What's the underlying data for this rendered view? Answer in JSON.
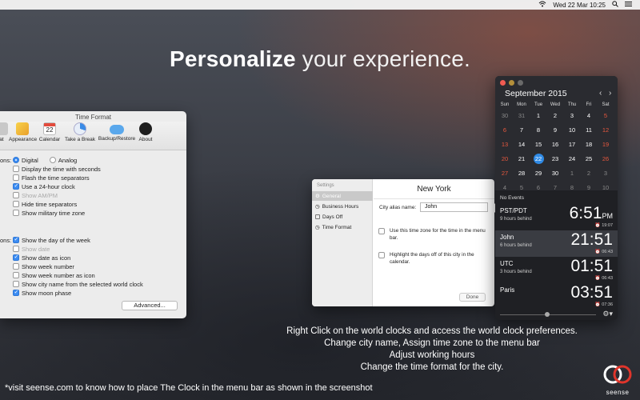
{
  "menubar": {
    "datetime": "Wed 22 Mar 10:25"
  },
  "headline": {
    "bold": "Personalize",
    "rest": " your experience."
  },
  "time_format_window": {
    "title": "Time Format",
    "toolbar": [
      {
        "label": "at",
        "icon": "time-format-icon"
      },
      {
        "label": "Appearance",
        "icon": "appearance-icon"
      },
      {
        "label": "Calendar",
        "icon": "calendar-icon",
        "day": "22"
      },
      {
        "label": "Take a Break",
        "icon": "break-pie-icon"
      },
      {
        "label": "Backup/Restore",
        "icon": "cloud-icon"
      },
      {
        "label": "About",
        "icon": "about-clock-icon"
      }
    ],
    "section1_label": "ons:",
    "format_digital": "Digital",
    "format_analog": "Analog",
    "options1": [
      {
        "label": "Display the time with seconds",
        "checked": false,
        "disabled": false
      },
      {
        "label": "Flash the time separators",
        "checked": false,
        "disabled": false
      },
      {
        "label": "Use a 24-hour clock",
        "checked": true,
        "disabled": false
      },
      {
        "label": "Show AM/PM",
        "checked": false,
        "disabled": true
      },
      {
        "label": "Hide time separators",
        "checked": false,
        "disabled": false
      },
      {
        "label": "Show military time zone",
        "checked": false,
        "disabled": false
      }
    ],
    "section2_label": "ons:",
    "options2": [
      {
        "label": "Show the day of the week",
        "checked": true,
        "disabled": false
      },
      {
        "label": "Show date",
        "checked": false,
        "disabled": true
      },
      {
        "label": "Show date as icon",
        "checked": true,
        "disabled": false
      },
      {
        "label": "Show week number",
        "checked": false,
        "disabled": false
      },
      {
        "label": "Show week number as icon",
        "checked": false,
        "disabled": false
      },
      {
        "label": "Show city name from the selected world clock",
        "checked": false,
        "disabled": false
      },
      {
        "label": "Show moon phase",
        "checked": true,
        "disabled": false
      }
    ],
    "advanced_button": "Advanced..."
  },
  "settings_window": {
    "sidebar_title": "Settings",
    "sidebar_items": [
      "General",
      "Business Hours",
      "Days Off",
      "Time Format"
    ],
    "city": "New York",
    "alias_label": "City alias name:",
    "alias_value": "John",
    "option_menubar": "Use this time zone for the time in the menu bar.",
    "option_daysoff": "Highlight the days off of this city in the calendar.",
    "done_button": "Done"
  },
  "calendar": {
    "month_title": "September 2015",
    "weekdays": [
      "Sun",
      "Mon",
      "Tue",
      "Wed",
      "Thu",
      "Fri",
      "Sat"
    ],
    "weeks": [
      [
        "30",
        "31",
        "1",
        "2",
        "3",
        "4",
        "5"
      ],
      [
        "6",
        "7",
        "8",
        "9",
        "10",
        "11",
        "12"
      ],
      [
        "13",
        "14",
        "15",
        "16",
        "17",
        "18",
        "19"
      ],
      [
        "20",
        "21",
        "22",
        "23",
        "24",
        "25",
        "26"
      ],
      [
        "27",
        "28",
        "29",
        "30",
        "1",
        "2",
        "3"
      ],
      [
        "4",
        "5",
        "6",
        "7",
        "8",
        "9",
        "10"
      ]
    ],
    "today": "22",
    "no_events": "No Events",
    "accent_color": "#2f8ae5",
    "weekend_color": "#e8583e"
  },
  "world_clocks": [
    {
      "name": "PST/PDT",
      "subtitle": "9 hours behind",
      "time": "6:51",
      "suffix": "PM",
      "alarm": "19:07",
      "selected": false
    },
    {
      "name": "John",
      "subtitle": "6 hours behind",
      "time": "21:51",
      "suffix": "",
      "alarm": "06:43",
      "selected": true
    },
    {
      "name": "UTC",
      "subtitle": "3 hours behind",
      "time": "01:51",
      "suffix": "",
      "alarm": "06:43",
      "selected": false
    },
    {
      "name": "Paris",
      "subtitle": "",
      "time": "03:51",
      "suffix": "",
      "alarm": "07:36",
      "selected": false
    }
  ],
  "caption_lines": [
    "Right Click on the world clocks and access the world clock preferences.",
    "Change city name, Assign time zone to the menu bar",
    "Adjust working hours",
    "Change the time format for the city."
  ],
  "footnote": "*visit seense.com to know how to place The Clock in the menu bar as shown in the screenshot",
  "logo_text": "seense"
}
